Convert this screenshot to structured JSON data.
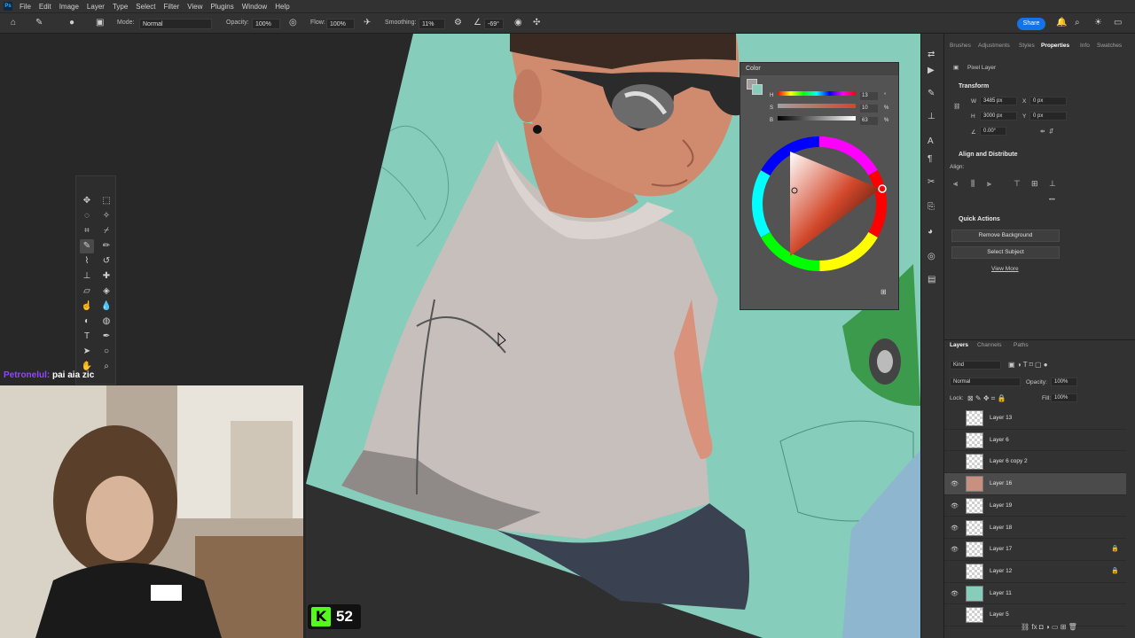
{
  "menu": {
    "logo": "Ps",
    "items": [
      "File",
      "Edit",
      "Image",
      "Layer",
      "Type",
      "Select",
      "Filter",
      "View",
      "Plugins",
      "Window",
      "Help"
    ]
  },
  "options": {
    "mode_label": "Mode:",
    "mode_value": "Normal",
    "opacity_label": "Opacity:",
    "opacity_value": "100%",
    "flow_label": "Flow:",
    "flow_value": "100%",
    "smoothing_label": "Smoothing:",
    "smoothing_value": "11%",
    "angle_value": "-69°",
    "share_label": "Share"
  },
  "chat": {
    "user": "Petronelul:",
    "message": "pai aia zic"
  },
  "kick": {
    "logo": "K",
    "count": "52"
  },
  "color_panel": {
    "title": "Color",
    "h_label": "H",
    "h_value": "13",
    "s_label": "S",
    "s_value": "10",
    "s_unit": "%",
    "b_label": "B",
    "b_value": "63",
    "b_unit": "%",
    "h_unit": "°"
  },
  "properties": {
    "tabs": [
      "Brushes",
      "Adjustments",
      "Styles",
      "Properties",
      "Info",
      "Swatches"
    ],
    "active_tab": "Properties",
    "layer_type": "Pixel Layer",
    "transform_title": "Transform",
    "w_label": "W",
    "w_value": "3485 px",
    "h_label": "H",
    "h_value": "3000 px",
    "x_label": "X",
    "x_value": "0 px",
    "y_label": "Y",
    "y_value": "0 px",
    "angle_value": "0.00°",
    "align_title": "Align and Distribute",
    "align_label": "Align:",
    "quick_title": "Quick Actions",
    "remove_bg": "Remove Background",
    "select_subject": "Select Subject",
    "view_more": "View More"
  },
  "layers_panel": {
    "tabs": [
      "Layers",
      "Channels",
      "Paths"
    ],
    "filter_value": "Kind",
    "blend_value": "Normal",
    "opacity_label": "Opacity:",
    "opacity_value": "100%",
    "lock_label": "Lock:",
    "fill_label": "Fill:",
    "fill_value": "100%",
    "layers": [
      {
        "name": "Layer 13",
        "visible": false,
        "locked": false
      },
      {
        "name": "Layer 6",
        "visible": false,
        "locked": false
      },
      {
        "name": "Layer 6 copy 2",
        "visible": false,
        "locked": false
      },
      {
        "name": "Layer 16",
        "visible": true,
        "locked": false,
        "selected": true
      },
      {
        "name": "Layer 19",
        "visible": true,
        "locked": false
      },
      {
        "name": "Layer 18",
        "visible": true,
        "locked": false
      },
      {
        "name": "Layer 17",
        "visible": true,
        "locked": true
      },
      {
        "name": "Layer 12",
        "visible": false,
        "locked": true
      },
      {
        "name": "Layer 11",
        "visible": true,
        "locked": false
      },
      {
        "name": "Layer 5",
        "visible": false,
        "locked": false
      }
    ]
  },
  "colors": {
    "canvas_teal": "#86cdbb",
    "accent": "#1473e6",
    "kick_green": "#53fc18",
    "chat_purple": "#9146ff"
  }
}
